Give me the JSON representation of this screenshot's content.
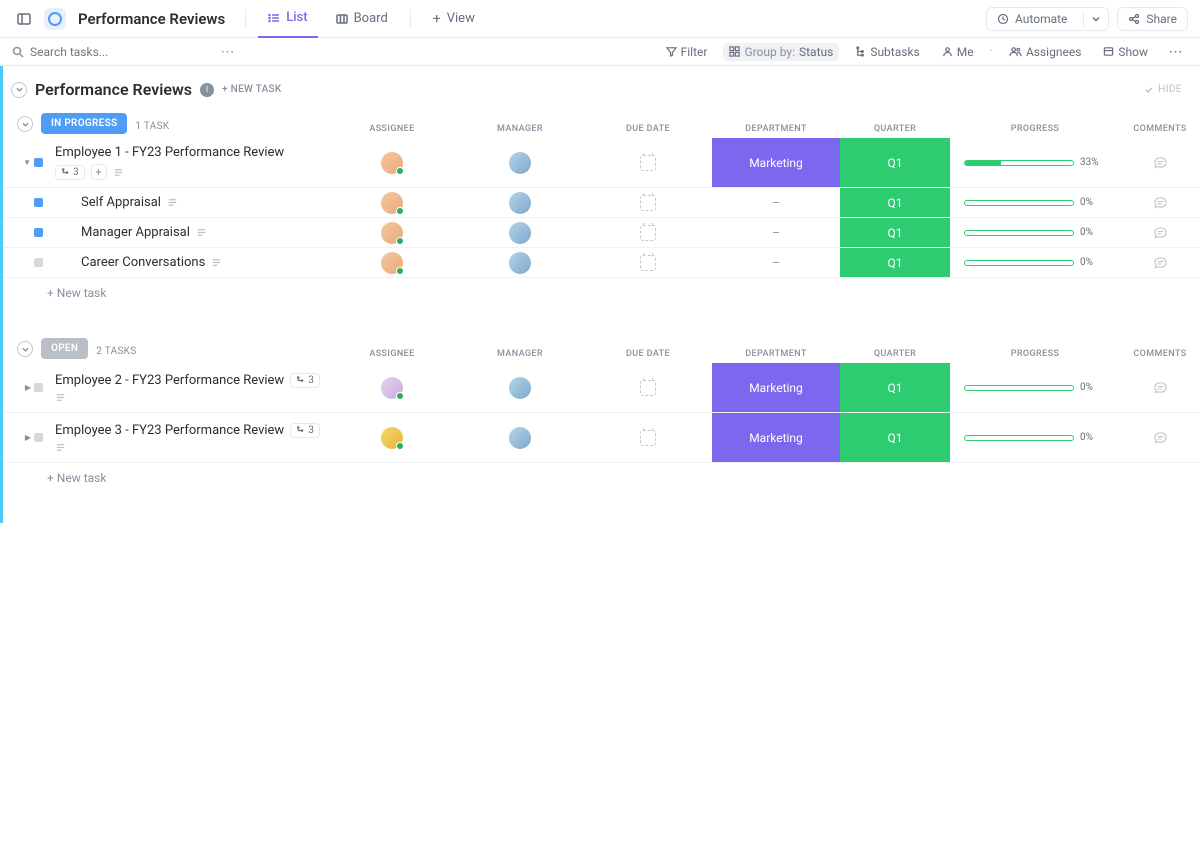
{
  "header": {
    "title": "Performance Reviews",
    "tabs": {
      "list": "List",
      "board": "Board",
      "view": "View"
    },
    "automate": "Automate",
    "share": "Share"
  },
  "toolbar": {
    "search_placeholder": "Search tasks...",
    "filter": "Filter",
    "groupby_label": "Group by:",
    "groupby_value": "Status",
    "subtasks": "Subtasks",
    "me": "Me",
    "assignees": "Assignees",
    "show": "Show"
  },
  "list": {
    "title": "Performance Reviews",
    "new_task": "+ NEW TASK",
    "hide": "HIDE",
    "add_task": "+ New task"
  },
  "columns": {
    "assignee": "ASSIGNEE",
    "manager": "MANAGER",
    "duedate": "DUE DATE",
    "department": "DEPARTMENT",
    "quarter": "QUARTER",
    "progress": "PROGRESS",
    "comments": "COMMENTS"
  },
  "groups": [
    {
      "status": "IN PROGRESS",
      "count": "1 TASK",
      "color": "progress",
      "tasks": [
        {
          "name": "Employee 1 - FY23 Performance Review",
          "subcount": "3",
          "dept": "Marketing",
          "quarter": "Q1",
          "progress_pct": 33,
          "progress_label": "33%",
          "avatar": "a1",
          "expanded": true,
          "subtasks": [
            {
              "name": "Self Appraisal",
              "status": "progress",
              "quarter": "Q1",
              "progress_label": "0%",
              "avatar": "a1"
            },
            {
              "name": "Manager Appraisal",
              "status": "progress",
              "quarter": "Q1",
              "progress_label": "0%",
              "avatar": "a1"
            },
            {
              "name": "Career Conversations",
              "status": "grey",
              "quarter": "Q1",
              "progress_label": "0%",
              "avatar": "a1"
            }
          ]
        }
      ]
    },
    {
      "status": "OPEN",
      "count": "2 TASKS",
      "color": "open",
      "tasks": [
        {
          "name": "Employee 2 - FY23 Performance Review",
          "subcount": "3",
          "dept": "Marketing",
          "quarter": "Q1",
          "progress_pct": 0,
          "progress_label": "0%",
          "avatar": "a3",
          "expanded": false
        },
        {
          "name": "Employee 3 - FY23 Performance Review",
          "subcount": "3",
          "dept": "Marketing",
          "quarter": "Q1",
          "progress_pct": 0,
          "progress_label": "0%",
          "avatar": "a4",
          "expanded": false
        }
      ]
    }
  ]
}
